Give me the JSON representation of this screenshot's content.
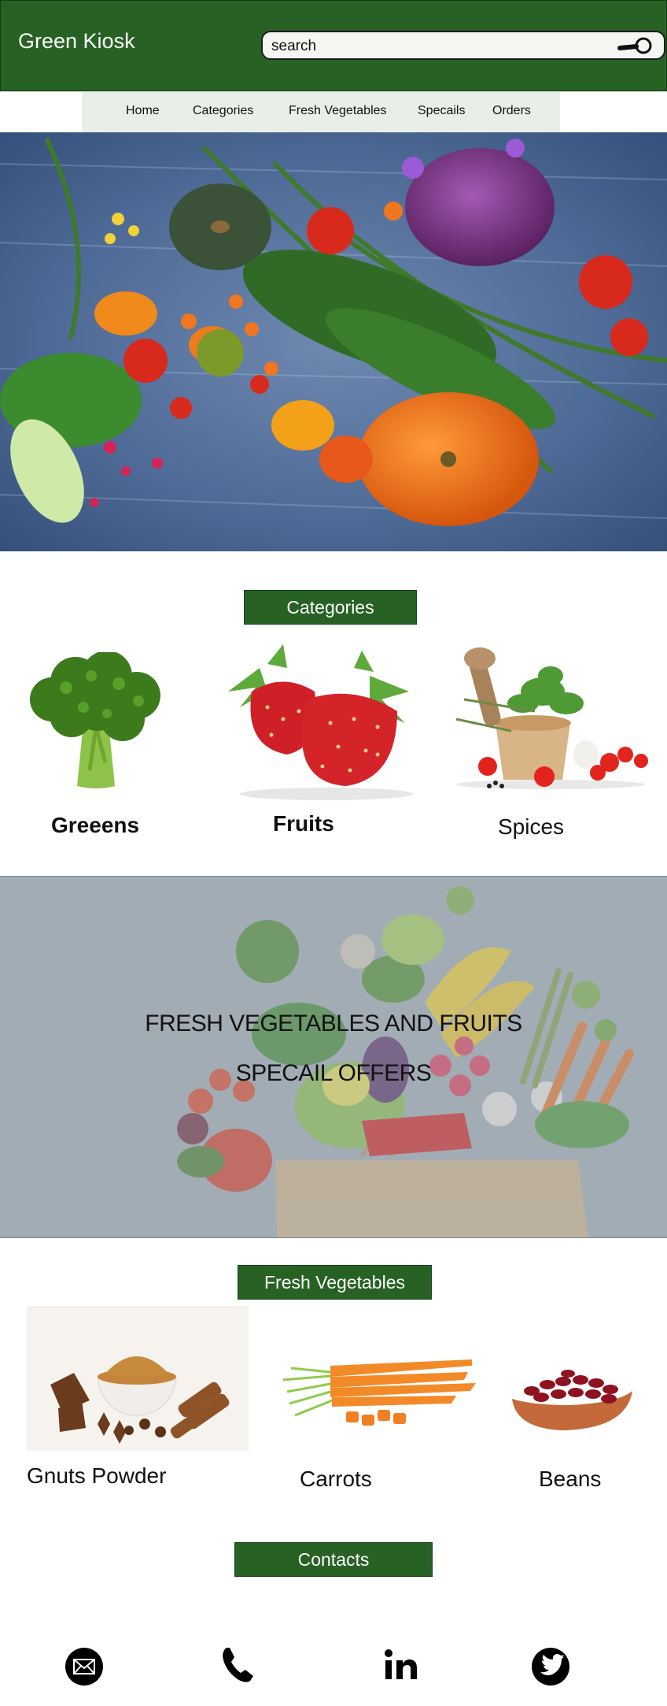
{
  "header": {
    "brand": "Green Kiosk",
    "search_value": "search"
  },
  "nav": {
    "items": [
      "Home",
      "Categories",
      "Fresh Vegetables",
      "Specails",
      "Orders"
    ]
  },
  "categories": {
    "title": "Categories",
    "items": [
      {
        "label": "Greeens",
        "icon": "broccoli-image"
      },
      {
        "label": "Fruits",
        "icon": "strawberries-image"
      },
      {
        "label": "Spices",
        "icon": "mortar-herbs-image"
      }
    ]
  },
  "banner": {
    "line1": "FRESH VEGETABLES AND FRUITS",
    "line2": "SPECAIL  OFFERS"
  },
  "fresh_vegetables": {
    "title": "Fresh Vegetables",
    "items": [
      {
        "label": "Gnuts  Powder",
        "icon": "spice-powder-image"
      },
      {
        "label": "Carrots",
        "icon": "carrots-image"
      },
      {
        "label": "Beans",
        "icon": "beans-image"
      }
    ]
  },
  "contacts": {
    "title": "Contacts",
    "icons": [
      "email-icon",
      "phone-icon",
      "linkedin-icon",
      "twitter-icon"
    ]
  },
  "colors": {
    "brand_green": "#276224",
    "nav_bg": "#e9eee8"
  }
}
